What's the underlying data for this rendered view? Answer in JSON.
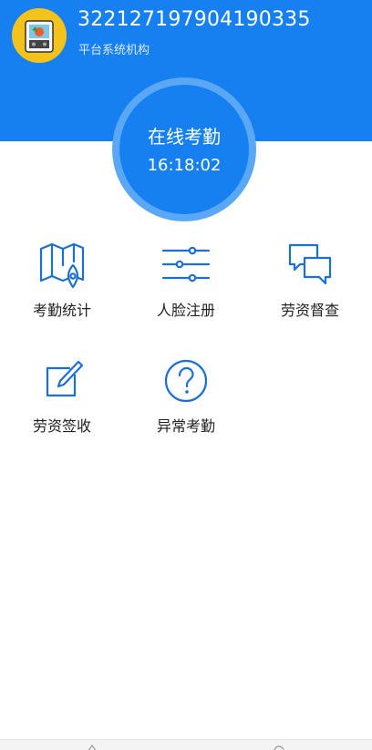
{
  "header": {
    "user_id": "322127197904190335",
    "org_name": "平台系统机构"
  },
  "clock": {
    "title": "在线考勤",
    "time": "16:18:02"
  },
  "menu": {
    "items": [
      {
        "label": "考勤统计",
        "icon": "map-pin-icon"
      },
      {
        "label": "人脸注册",
        "icon": "sliders-icon"
      },
      {
        "label": "劳资督查",
        "icon": "chat-bubbles-icon"
      },
      {
        "label": "劳资签收",
        "icon": "edit-icon"
      },
      {
        "label": "异常考勤",
        "icon": "question-icon"
      }
    ]
  },
  "colors": {
    "primary": "#1680f1",
    "ring": "#5aa8f5",
    "icon": "#1b6fd6"
  }
}
